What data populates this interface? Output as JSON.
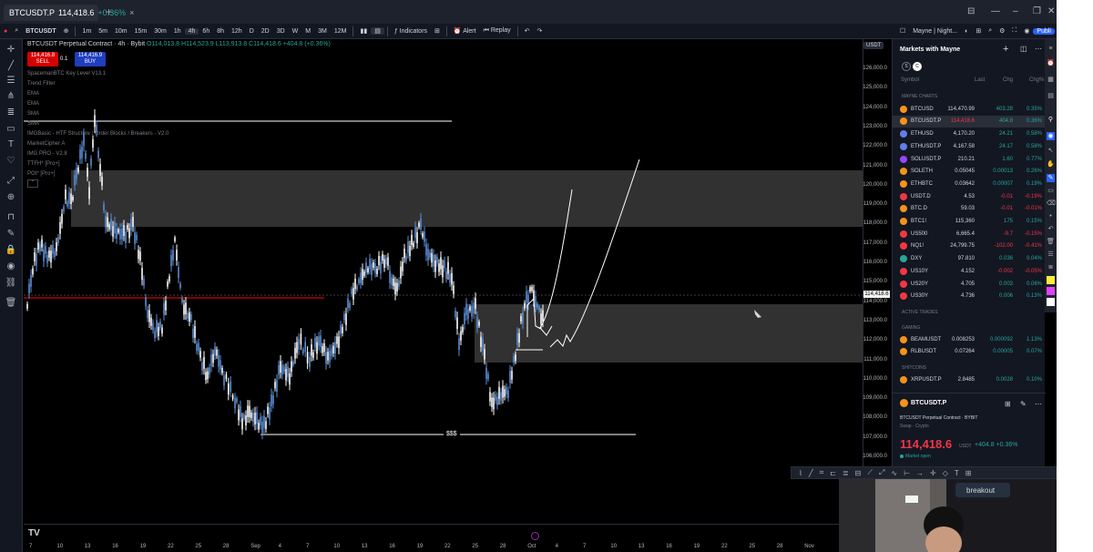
{
  "tab": {
    "title": "BTCUSDT.P",
    "price": "114,418.6",
    "change": "+0.36%"
  },
  "toolbar": {
    "symbol": "BTCUSDT",
    "intervals": [
      "1m",
      "5m",
      "10m",
      "15m",
      "30m",
      "1h",
      "4h",
      "6h",
      "8h",
      "12h",
      "D",
      "2D",
      "3D",
      "W",
      "M",
      "3M",
      "12M"
    ],
    "active_interval": "4h",
    "indicators": "Indicators",
    "alert": "Alert",
    "replay": "Replay",
    "layout_name": "Mayne | Night...",
    "publish": "Publi"
  },
  "legend": {
    "title": "BTCUSDT Perpetual Contract · 4h · Bybit",
    "ohlc": "O114,013.8 H114,523.9 L113,913.8 C114,418.6 +404.8 (+0.36%)",
    "sell_price": "114,416.8",
    "sell_label": "SELL",
    "spread": "0.1",
    "buy_price": "114,416.9",
    "buy_label": "BUY",
    "indicators": [
      "SpacemanBTC Key Level V13.1",
      "Trend Filter",
      "EMA",
      "EMA",
      "SMA",
      "SMA",
      "IMGBasic - HTF Structure / Order Blocks / Breakers - V2.0",
      "MarketCipher A",
      "IMG PRO - V2.8",
      "TTFH* [Pro+]",
      "POI* [Pro+]"
    ],
    "dollar_label": "$$$"
  },
  "price_axis": {
    "currency": "USDT",
    "labels": [
      "126,000.0",
      "125,000.0",
      "124,000.0",
      "123,000.0",
      "122,000.0",
      "121,000.0",
      "120,000.0",
      "119,000.0",
      "118,000.0",
      "117,000.0",
      "116,000.0",
      "115,000.0",
      "114,000.0",
      "113,000.0",
      "112,000.0",
      "111,000.0",
      "110,000.0",
      "109,000.0",
      "108,000.0",
      "107,000.0",
      "106,000.0"
    ],
    "current": "114,418.6"
  },
  "time_axis": {
    "labels": [
      "7",
      "10",
      "13",
      "16",
      "19",
      "22",
      "25",
      "28",
      "Sep",
      "4",
      "7",
      "10",
      "13",
      "16",
      "19",
      "22",
      "25",
      "28",
      "Oct",
      "4",
      "7",
      "10",
      "13",
      "16",
      "19",
      "22",
      "25",
      "28",
      "Nov"
    ]
  },
  "watchlist": {
    "title": "Markets with Mayne",
    "columns": [
      "Symbol",
      "Last",
      "Chg",
      "Chg%"
    ],
    "sections": {
      "mayne": "MAYNE CHARTS",
      "active": "ACTIVE TRADES",
      "gaming": "GAMING",
      "shitcoins": "SHITCOINS"
    },
    "rows": [
      {
        "sym": "BTCUSD",
        "last": "114,470.99",
        "chg": "403.28",
        "pct": "0.35%",
        "dir": "pos",
        "color": "#f7931a"
      },
      {
        "sym": "BTCUSDT.P",
        "last": "114,418.6",
        "chg": "404.8",
        "pct": "0.36%",
        "dir": "pos",
        "color": "#f7931a"
      },
      {
        "sym": "ETHUSD",
        "last": "4,170.20",
        "chg": "24.21",
        "pct": "0.58%",
        "dir": "pos",
        "color": "#627eea"
      },
      {
        "sym": "ETHUSDT.P",
        "last": "4,167.58",
        "chg": "24.17",
        "pct": "0.58%",
        "dir": "pos",
        "color": "#627eea"
      },
      {
        "sym": "SOLUSDT.P",
        "last": "210.21",
        "chg": "1.60",
        "pct": "0.77%",
        "dir": "pos",
        "color": "#9945ff"
      },
      {
        "sym": "SOLETH",
        "last": "0.05045",
        "chg": "0.00013",
        "pct": "0.26%",
        "dir": "pos",
        "color": "#f7931a"
      },
      {
        "sym": "ETHBTC",
        "last": "0.03642",
        "chg": "0.00007",
        "pct": "0.19%",
        "dir": "pos",
        "color": "#f7931a"
      },
      {
        "sym": "USDT.D",
        "last": "4.53",
        "chg": "-0.01",
        "pct": "-0.19%",
        "dir": "neg",
        "color": "#f23645"
      },
      {
        "sym": "BTC.D",
        "last": "59.03",
        "chg": "-0.01",
        "pct": "-0.01%",
        "dir": "neg",
        "color": "#f7931a"
      },
      {
        "sym": "BTC1!",
        "last": "115,360",
        "chg": "175",
        "pct": "0.15%",
        "dir": "pos",
        "color": "#f7931a"
      },
      {
        "sym": "US500",
        "last": "6,665.4",
        "chg": "-9.7",
        "pct": "-0.15%",
        "dir": "neg",
        "color": "#f23645"
      },
      {
        "sym": "NQ1!",
        "last": "24,799.75",
        "chg": "-102.00",
        "pct": "-0.41%",
        "dir": "neg",
        "color": "#f23645"
      },
      {
        "sym": "DXY",
        "last": "97.810",
        "chg": "0.036",
        "pct": "0.04%",
        "dir": "pos",
        "color": "#26a69a"
      },
      {
        "sym": "US10Y",
        "last": "4.152",
        "chg": "-0.002",
        "pct": "-0.05%",
        "dir": "neg",
        "color": "#f23645"
      },
      {
        "sym": "US20Y",
        "last": "4.705",
        "chg": "0.003",
        "pct": "0.06%",
        "dir": "pos",
        "color": "#f23645"
      },
      {
        "sym": "US30Y",
        "last": "4.736",
        "chg": "0.006",
        "pct": "0.13%",
        "dir": "pos",
        "color": "#f23645"
      },
      {
        "sym": "BEAMUSDT",
        "last": "0.008253",
        "chg": "0.000092",
        "pct": "1.13%",
        "dir": "pos",
        "color": "#f7931a"
      },
      {
        "sym": "RLBUSDT",
        "last": "0.07264",
        "chg": "0.00005",
        "pct": "0.07%",
        "dir": "pos",
        "color": "#f7931a"
      },
      {
        "sym": "XRPUSDT.P",
        "last": "2.8485",
        "chg": "0.0028",
        "pct": "0.10%",
        "dir": "pos",
        "color": "#f7931a"
      }
    ]
  },
  "detail": {
    "symbol": "BTCUSDT.P",
    "name": "BTCUSDT Perpetual Contract · BYBIT",
    "type": "Swap · Crypto",
    "price": "114,418.6",
    "unit": "USDT",
    "change": "+404.8 +0.36%",
    "status": "Market open"
  }
}
